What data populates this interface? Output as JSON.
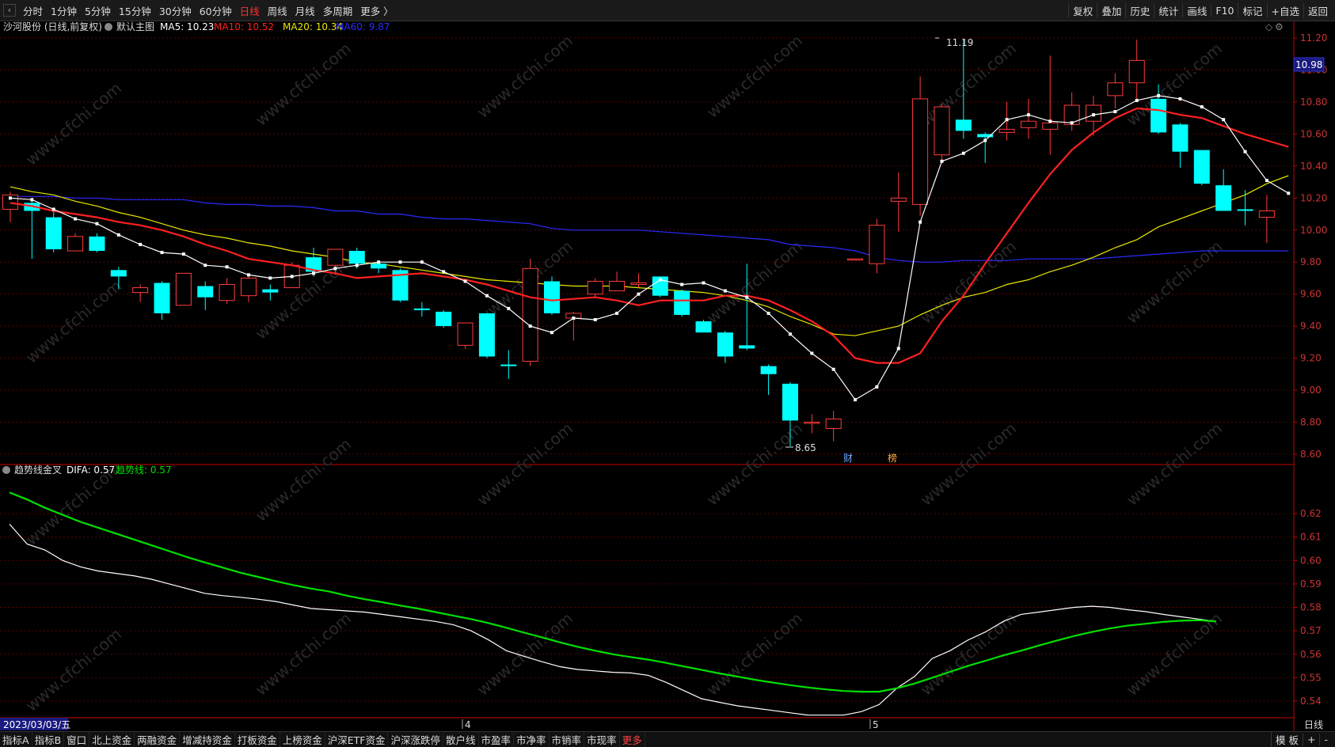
{
  "toolbar": {
    "back_icon": "chevron-left-icon",
    "timeframes": [
      "分时",
      "1分钟",
      "5分钟",
      "15分钟",
      "30分钟",
      "60分钟",
      "日线",
      "周线",
      "月线",
      "多周期",
      "更多 〉"
    ],
    "active_timeframe": "日线",
    "tools": [
      "复权",
      "叠加",
      "历史",
      "统计",
      "画线",
      "F10",
      "标记",
      "+自选",
      "返回"
    ]
  },
  "main_header": {
    "stock": "沙河股份 (日线,前复权)",
    "template": "默认主图",
    "ma5": "MA5: 10.23",
    "ma10": "MA10: 10.52",
    "ma20": "MA20: 10.34",
    "ma60": "MA60: 9.87"
  },
  "sub_header": {
    "name": "趋势线金叉",
    "difa": "DIFA: 0.57",
    "trend": "趋势线: 0.57"
  },
  "annotations": {
    "high_label": "11.19",
    "low_label": "8.65",
    "marker_cai": "财",
    "marker_bang": "榜",
    "current_price": "10.98",
    "date_label": "2023/03/03/五",
    "month_4": "4",
    "month_5": "5",
    "period": "日线"
  },
  "bottom": {
    "tabs": [
      "指标A",
      "指标B",
      "窗口",
      "北上资金",
      "两融资金",
      "增减持资金",
      "打板资金",
      "上榜资金",
      "沪深ETF资金",
      "沪深涨跌停",
      "散户线",
      "市盈率",
      "市净率",
      "市销率",
      "市现率",
      "更多"
    ],
    "right": [
      "模 板",
      "+",
      "-"
    ]
  },
  "colors": {
    "up": "#ff3c3c",
    "down": "#00ffff",
    "ma5": "#ffffff",
    "ma10": "#ff2020",
    "ma20": "#e8e800",
    "ma60": "#2a2aff",
    "trend": "#00e000",
    "difa": "#ffffff",
    "axis": "#cc0000",
    "grid": "#5a0000"
  },
  "chart_data": [
    {
      "type": "candlestick",
      "title": "沙河股份 (日线,前复权)",
      "price_axis_ticks": [
        "11.20",
        "11.00",
        "10.80",
        "10.60",
        "10.40",
        "10.20",
        "10.00",
        "9.80",
        "9.60",
        "9.40",
        "9.20",
        "9.00",
        "8.80",
        "8.60"
      ],
      "ylim": [
        8.56,
        11.22
      ],
      "candles": [
        [
          10.13,
          10.22,
          10.05,
          10.24
        ],
        [
          10.17,
          10.12,
          9.82,
          10.2
        ],
        [
          10.08,
          9.88,
          9.86,
          10.12
        ],
        [
          9.87,
          9.96,
          9.87,
          9.98
        ],
        [
          9.96,
          9.87,
          9.86,
          9.98
        ],
        [
          9.75,
          9.71,
          9.63,
          9.77
        ],
        [
          9.61,
          9.64,
          9.55,
          9.66
        ],
        [
          9.67,
          9.48,
          9.44,
          9.68
        ],
        [
          9.53,
          9.73,
          9.53,
          9.73
        ],
        [
          9.65,
          9.58,
          9.5,
          9.68
        ],
        [
          9.56,
          9.66,
          9.54,
          9.7
        ],
        [
          9.59,
          9.7,
          9.55,
          9.71
        ],
        [
          9.63,
          9.61,
          9.56,
          9.66
        ],
        [
          9.64,
          9.78,
          9.64,
          9.8
        ],
        [
          9.83,
          9.74,
          9.71,
          9.89
        ],
        [
          9.78,
          9.88,
          9.72,
          9.88
        ],
        [
          9.87,
          9.79,
          9.76,
          9.89
        ],
        [
          9.79,
          9.76,
          9.73,
          9.8
        ],
        [
          9.75,
          9.56,
          9.55,
          9.76
        ],
        [
          9.51,
          9.5,
          9.46,
          9.55
        ],
        [
          9.49,
          9.4,
          9.39,
          9.5
        ],
        [
          9.28,
          9.42,
          9.26,
          9.42
        ],
        [
          9.48,
          9.21,
          9.2,
          9.48
        ],
        [
          9.16,
          9.15,
          9.07,
          9.25
        ],
        [
          9.18,
          9.76,
          9.15,
          9.82
        ],
        [
          9.68,
          9.48,
          9.47,
          9.71
        ],
        [
          9.45,
          9.48,
          9.31,
          9.49
        ],
        [
          9.6,
          9.68,
          9.58,
          9.7
        ],
        [
          9.62,
          9.68,
          9.62,
          9.74
        ],
        [
          9.66,
          9.67,
          9.64,
          9.73
        ],
        [
          9.71,
          9.59,
          9.58,
          9.71
        ],
        [
          9.62,
          9.47,
          9.46,
          9.63
        ],
        [
          9.43,
          9.36,
          9.36,
          9.44
        ],
        [
          9.36,
          9.21,
          9.17,
          9.37
        ],
        [
          9.28,
          9.26,
          9.25,
          9.79
        ],
        [
          9.15,
          9.1,
          8.97,
          9.16
        ],
        [
          9.04,
          8.81,
          8.65,
          9.05
        ],
        [
          8.8,
          8.8,
          8.73,
          8.85
        ],
        [
          8.76,
          8.82,
          8.68,
          8.87
        ],
        [
          9.82,
          9.82,
          9.82,
          9.82
        ],
        [
          9.79,
          10.03,
          9.73,
          10.07
        ],
        [
          10.18,
          10.2,
          9.99,
          10.36
        ],
        [
          10.16,
          10.82,
          10.09,
          10.96
        ],
        [
          10.47,
          10.77,
          10.44,
          10.79
        ],
        [
          10.69,
          10.62,
          10.57,
          11.19
        ],
        [
          10.6,
          10.58,
          10.42,
          10.61
        ],
        [
          10.61,
          10.63,
          10.56,
          10.8
        ],
        [
          10.64,
          10.68,
          10.57,
          10.82
        ],
        [
          10.63,
          10.67,
          10.47,
          11.09
        ],
        [
          10.66,
          10.78,
          10.62,
          10.86
        ],
        [
          10.68,
          10.78,
          10.59,
          10.84
        ],
        [
          10.84,
          10.92,
          10.76,
          10.98
        ],
        [
          10.92,
          11.06,
          10.82,
          11.19
        ],
        [
          10.82,
          10.61,
          10.6,
          10.91
        ],
        [
          10.66,
          10.49,
          10.39,
          10.67
        ],
        [
          10.5,
          10.29,
          10.28,
          10.5
        ],
        [
          10.28,
          10.12,
          10.12,
          10.38
        ],
        [
          10.13,
          10.12,
          10.03,
          10.25
        ],
        [
          10.08,
          10.12,
          9.92,
          10.22
        ]
      ],
      "ma5": [
        10.2,
        10.19,
        10.13,
        10.07,
        10.04,
        9.97,
        9.91,
        9.86,
        9.85,
        9.78,
        9.77,
        9.72,
        9.7,
        9.71,
        9.73,
        9.76,
        9.78,
        9.8,
        9.8,
        9.8,
        9.74,
        9.68,
        9.59,
        9.51,
        9.4,
        9.36,
        9.45,
        9.44,
        9.48,
        9.6,
        9.69,
        9.66,
        9.67,
        9.62,
        9.58,
        9.48,
        9.35,
        9.23,
        9.13,
        8.94,
        9.02,
        9.26,
        10.05,
        10.43,
        10.48,
        10.56,
        10.69,
        10.72,
        10.68,
        10.67,
        10.72,
        10.74,
        10.81,
        10.84,
        10.82,
        10.77,
        10.69,
        10.49,
        10.31,
        10.23
      ],
      "ma10": [
        10.17,
        10.15,
        10.12,
        10.1,
        10.08,
        10.05,
        10.03,
        10.0,
        9.96,
        9.91,
        9.87,
        9.82,
        9.8,
        9.78,
        9.75,
        9.73,
        9.7,
        9.71,
        9.72,
        9.73,
        9.71,
        9.69,
        9.66,
        9.62,
        9.58,
        9.56,
        9.57,
        9.58,
        9.56,
        9.53,
        9.56,
        9.56,
        9.56,
        9.59,
        9.59,
        9.56,
        9.5,
        9.43,
        9.34,
        9.2,
        9.17,
        9.17,
        9.23,
        9.43,
        9.59,
        9.79,
        9.98,
        10.17,
        10.35,
        10.5,
        10.61,
        10.7,
        10.76,
        10.75,
        10.72,
        10.7,
        10.65,
        10.6,
        10.56,
        10.52
      ],
      "ma20": [
        10.27,
        10.24,
        10.22,
        10.18,
        10.15,
        10.11,
        10.08,
        10.04,
        10.0,
        9.97,
        9.95,
        9.92,
        9.9,
        9.87,
        9.85,
        9.83,
        9.8,
        9.79,
        9.77,
        9.75,
        9.73,
        9.71,
        9.69,
        9.68,
        9.67,
        9.66,
        9.65,
        9.65,
        9.65,
        9.64,
        9.63,
        9.62,
        9.61,
        9.59,
        9.56,
        9.52,
        9.46,
        9.41,
        9.35,
        9.34,
        9.37,
        9.4,
        9.47,
        9.53,
        9.58,
        9.61,
        9.66,
        9.69,
        9.74,
        9.78,
        9.83,
        9.89,
        9.94,
        10.02,
        10.07,
        10.12,
        10.17,
        10.22,
        10.29,
        10.34
      ],
      "ma60": [
        10.21,
        10.21,
        10.21,
        10.2,
        10.2,
        10.19,
        10.19,
        10.19,
        10.19,
        10.17,
        10.16,
        10.16,
        10.15,
        10.15,
        10.14,
        10.12,
        10.12,
        10.1,
        10.1,
        10.08,
        10.07,
        10.07,
        10.06,
        10.05,
        10.04,
        10.01,
        10.0,
        10.0,
        10.0,
        10.0,
        9.99,
        9.98,
        9.97,
        9.96,
        9.95,
        9.94,
        9.91,
        9.9,
        9.89,
        9.87,
        9.83,
        9.81,
        9.8,
        9.8,
        9.81,
        9.81,
        9.81,
        9.82,
        9.82,
        9.82,
        9.82,
        9.83,
        9.84,
        9.85,
        9.86,
        9.87,
        9.87,
        9.87,
        9.87,
        9.87
      ]
    },
    {
      "type": "line",
      "title": "趋势线金叉",
      "y_ticks": [
        "0.62",
        "0.61",
        "0.60",
        "0.59",
        "0.58",
        "0.57",
        "0.56",
        "0.55",
        "0.54"
      ],
      "ylim": [
        0.5329,
        0.6332
      ],
      "series": [
        {
          "name": "DIFA",
          "values": [
            0.6155,
            0.607,
            0.6045,
            0.6,
            0.5973,
            0.5955,
            0.5945,
            0.5935,
            0.592,
            0.59,
            0.588,
            0.586,
            0.585,
            0.5843,
            0.5835,
            0.5825,
            0.581,
            0.5795,
            0.579,
            0.5785,
            0.578,
            0.577,
            0.576,
            0.575,
            0.574,
            0.5726,
            0.57,
            0.5661,
            0.5615,
            0.5591,
            0.5568,
            0.5547,
            0.5535,
            0.5529,
            0.5523,
            0.552,
            0.551,
            0.548,
            0.5445,
            0.541,
            0.5395,
            0.538,
            0.537,
            0.536,
            0.535,
            0.534,
            0.534,
            0.534,
            0.5355,
            0.5385,
            0.5455,
            0.5505,
            0.5582,
            0.5615,
            0.566,
            0.5695,
            0.574,
            0.577,
            0.578,
            0.579,
            0.58,
            0.5805,
            0.58,
            0.579,
            0.5782,
            0.577,
            0.576,
            0.575,
            0.574
          ]
        },
        {
          "name": "趋势线",
          "values": [
            0.629,
            0.626,
            0.6225,
            0.6195,
            0.6165,
            0.614,
            0.6115,
            0.609,
            0.6065,
            0.604,
            0.6015,
            0.5992,
            0.597,
            0.5948,
            0.593,
            0.5912,
            0.5895,
            0.588,
            0.5868,
            0.585,
            0.5835,
            0.5822,
            0.5808,
            0.5795,
            0.578,
            0.5765,
            0.575,
            0.5733,
            0.5713,
            0.5692,
            0.5672,
            0.5651,
            0.5632,
            0.5615,
            0.56,
            0.5588,
            0.5577,
            0.5563,
            0.5548,
            0.5533,
            0.5518,
            0.5505,
            0.5491,
            0.5479,
            0.5468,
            0.5458,
            0.545,
            0.5443,
            0.544,
            0.544,
            0.5455,
            0.5475,
            0.55,
            0.5525,
            0.555,
            0.5572,
            0.5595,
            0.5615,
            0.5637,
            0.5658,
            0.5678,
            0.5695,
            0.571,
            0.5722,
            0.573,
            0.5738,
            0.5743,
            0.5745,
            0.574
          ]
        }
      ]
    }
  ]
}
